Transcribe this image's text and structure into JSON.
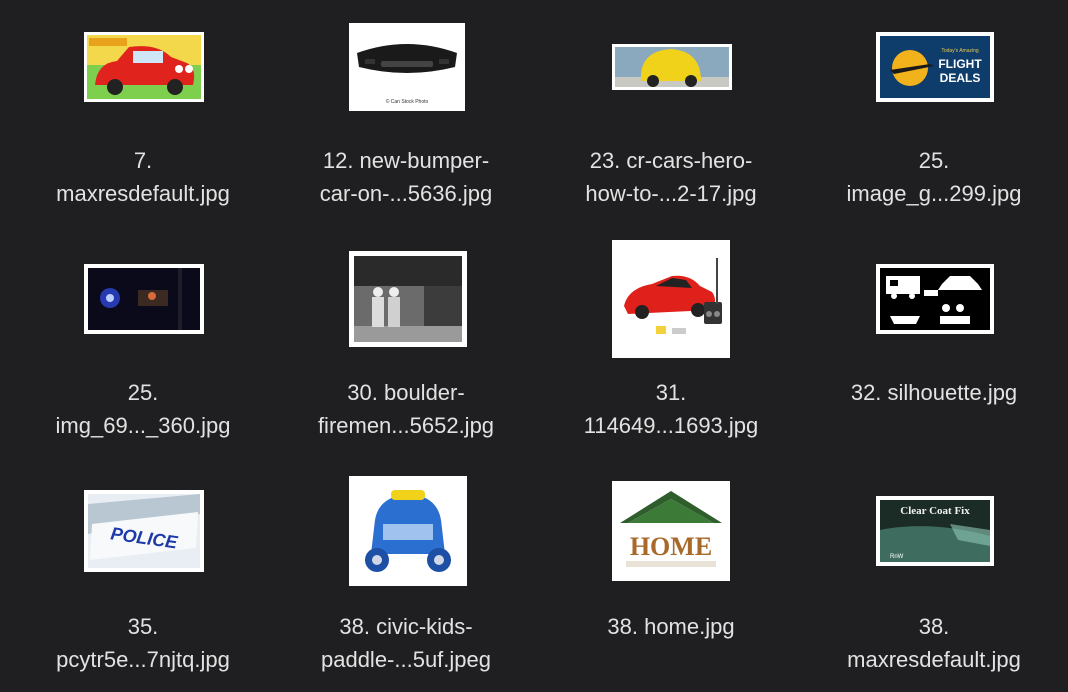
{
  "window": {
    "background": "#1f1f21"
  },
  "files": [
    {
      "line1": "7.",
      "line2": "maxresdefault.jpg",
      "thumb": "red-cartoon-car-image"
    },
    {
      "line1": "12. new-bumper-",
      "line2": "car-on-...5636.jpg",
      "thumb": "black-bumper-image",
      "thumb_text": "© Can Stock Photo"
    },
    {
      "line1": "23. cr-cars-hero-",
      "line2": "how-to-...2-17.jpg",
      "thumb": "yellow-car-image"
    },
    {
      "line1": "25.",
      "line2": "image_g...299.jpg",
      "thumb": "flight-deals-image",
      "thumb_text_top": "Today's Amazing",
      "thumb_text": "FLIGHT",
      "thumb_text2": "DEALS"
    },
    {
      "line1": "25.",
      "line2": "img_69..._360.jpg",
      "thumb": "police-lights-night-image"
    },
    {
      "line1": "30. boulder-",
      "line2": "firemen...5652.jpg",
      "thumb": "firemen-bw-image"
    },
    {
      "line1": "31.",
      "line2": "114649...1693.jpg",
      "thumb": "red-rc-car-image"
    },
    {
      "line1": "32. silhouette.jpg",
      "line2": "",
      "thumb": "vehicle-silhouettes-image"
    },
    {
      "line1": "35.",
      "line2": "pcytr5e...7njtq.jpg",
      "thumb": "police-car-door-image",
      "thumb_text": "POLICE"
    },
    {
      "line1": "38. civic-kids-",
      "line2": "paddle-...5uf.jpeg",
      "thumb": "blue-kids-car-image"
    },
    {
      "line1": "38. home.jpg",
      "line2": "",
      "thumb": "home-letters-image",
      "thumb_text": "HOME"
    },
    {
      "line1": "38.",
      "line2": "maxresdefault.jpg",
      "thumb": "clear-coat-fix-image",
      "thumb_text": "Clear Coat Fix",
      "thumb_text2": "RnW"
    }
  ]
}
